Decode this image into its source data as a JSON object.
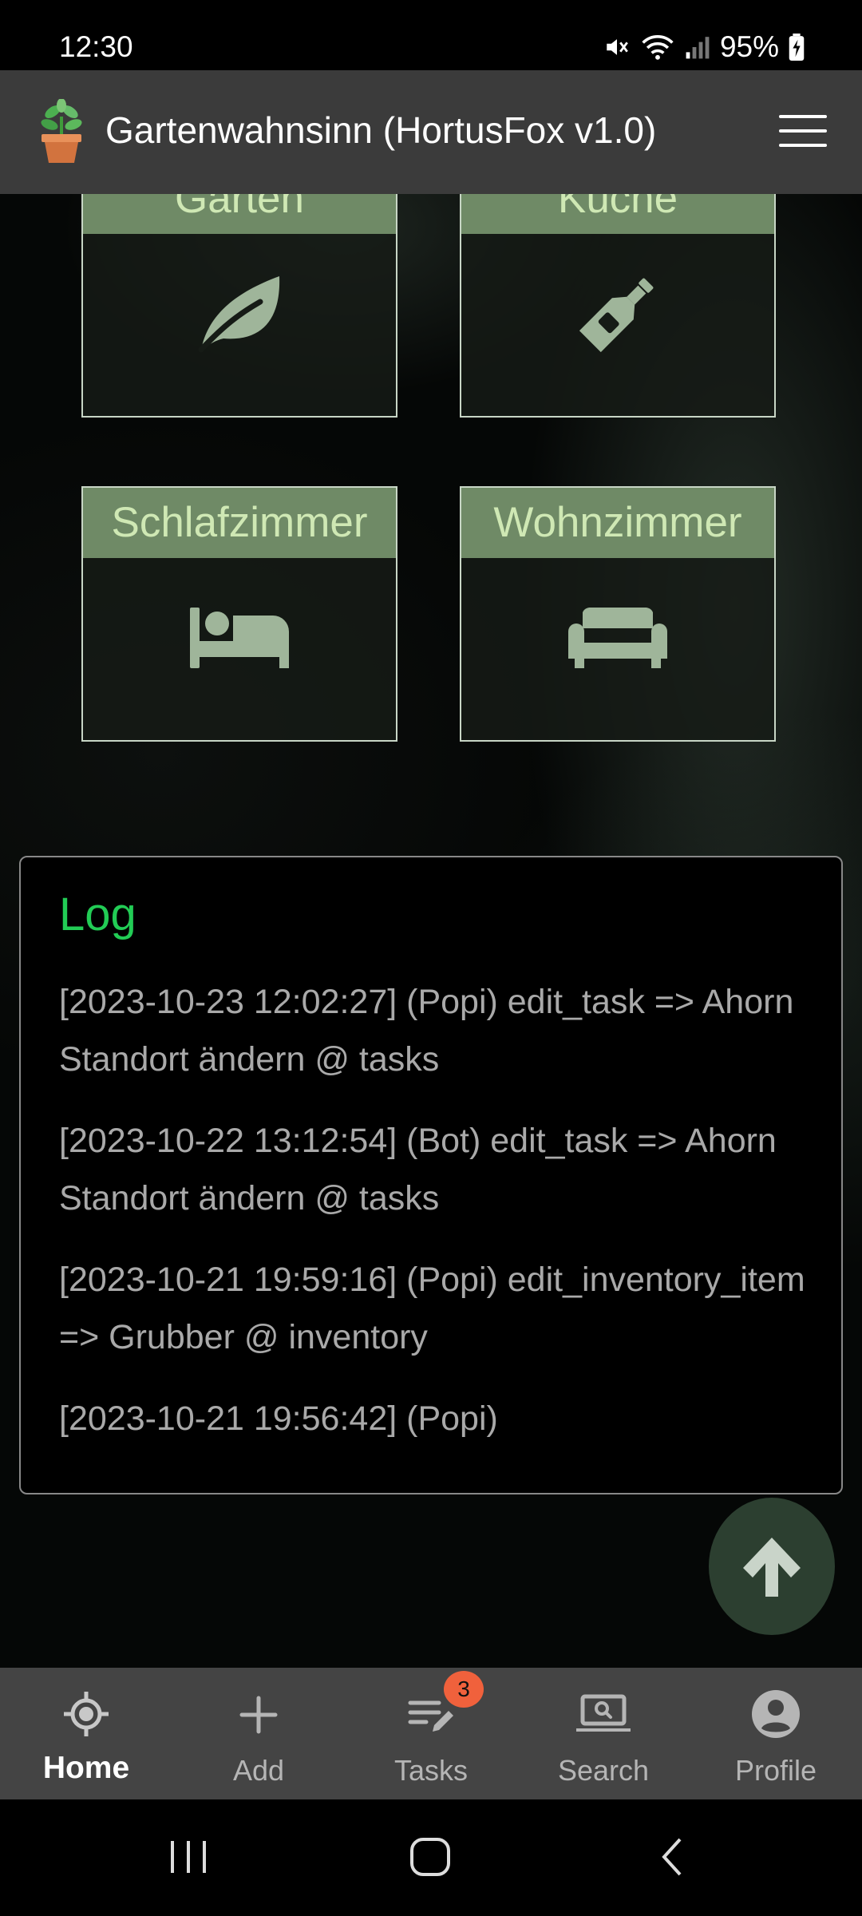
{
  "status_bar": {
    "time": "12:30",
    "battery": "95%",
    "icons": [
      "mute-icon",
      "wifi-icon",
      "signal-icon",
      "battery-charging-icon"
    ]
  },
  "header": {
    "title": "Gartenwahnsinn (HortusFox v1.0)",
    "logo_icon": "plant-pot-icon",
    "menu_icon": "hamburger-menu-icon"
  },
  "rooms": [
    {
      "label": "Garten",
      "icon": "leaf-icon"
    },
    {
      "label": "Küche",
      "icon": "bottle-icon"
    },
    {
      "label": "Schlafzimmer",
      "icon": "bed-icon"
    },
    {
      "label": "Wohnzimmer",
      "icon": "couch-icon"
    }
  ],
  "log": {
    "title": "Log",
    "entries": [
      "[2023-10-23 12:02:27] (Popi) edit_task => Ahorn Standort ändern @ tasks",
      "[2023-10-22 13:12:54] (Bot) edit_task => Ahorn Standort ändern @ tasks",
      "[2023-10-21 19:59:16] (Popi) edit_inventory_item => Grubber @ inventory",
      "[2023-10-21 19:56:42] (Popi)"
    ]
  },
  "scroll_top": {
    "icon": "arrow-up-icon"
  },
  "bottom_nav": {
    "items": [
      {
        "label": "Home",
        "icon": "home-crosshair-icon",
        "active": true
      },
      {
        "label": "Add",
        "icon": "plus-icon",
        "active": false
      },
      {
        "label": "Tasks",
        "icon": "tasks-edit-icon",
        "active": false,
        "badge": "3"
      },
      {
        "label": "Search",
        "icon": "laptop-search-icon",
        "active": false
      },
      {
        "label": "Profile",
        "icon": "user-circle-icon",
        "active": false
      }
    ]
  },
  "colors": {
    "header_bg": "#3b3b3b",
    "room_title_bg": "#6f8a66",
    "room_title_text": "#cfe8b4",
    "log_title": "#22cc55",
    "badge": "#f0613c",
    "nav_bg": "#444444"
  }
}
